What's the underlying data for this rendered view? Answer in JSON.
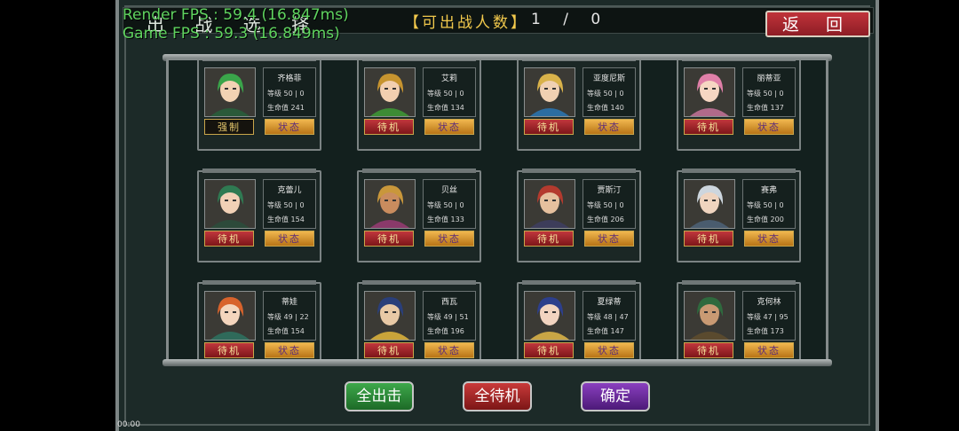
{
  "header": {
    "title": "出 战 选 择",
    "count_label": "【可出战人数】",
    "count_value": "1 / 0",
    "back_label": "返 回"
  },
  "debug": {
    "render_fps": "Render FPS : 59.4 (16.847ms)",
    "game_fps": "Game FPS : 59.3 (16.849ms)"
  },
  "status_label": "状态",
  "level_prefix": "等级",
  "hp_prefix": "生命值",
  "characters": [
    {
      "name": "齐格菲",
      "level": "50 | 0",
      "hp": "241",
      "state": "强制",
      "palette": {
        "hair": "#3aa54a",
        "skin": "#f2d2b3",
        "cloth": "#2a5a3a"
      }
    },
    {
      "name": "艾莉",
      "level": "50 | 0",
      "hp": "134",
      "state": "待机",
      "palette": {
        "hair": "#c7942f",
        "skin": "#f2cfb0",
        "cloth": "#3d8c35"
      }
    },
    {
      "name": "亚度尼斯",
      "level": "50 | 0",
      "hp": "140",
      "state": "待机",
      "palette": {
        "hair": "#d9b24a",
        "skin": "#f0d0b2",
        "cloth": "#2c6da1"
      }
    },
    {
      "name": "丽蒂亚",
      "level": "50 | 0",
      "hp": "137",
      "state": "待机",
      "palette": {
        "hair": "#e07fa8",
        "skin": "#f6d6c2",
        "cloth": "#b06a8a"
      }
    },
    {
      "name": "克蕾儿",
      "level": "50 | 0",
      "hp": "154",
      "state": "待机",
      "palette": {
        "hair": "#2f7a52",
        "skin": "#f2d1b6",
        "cloth": "#2d4a3a"
      }
    },
    {
      "name": "贝丝",
      "level": "50 | 0",
      "hp": "133",
      "state": "待机",
      "palette": {
        "hair": "#c9973b",
        "skin": "#c98c5e",
        "cloth": "#8a3a6a"
      }
    },
    {
      "name": "贾斯汀",
      "level": "50 | 0",
      "hp": "206",
      "state": "待机",
      "palette": {
        "hair": "#b43a2e",
        "skin": "#e6c09e",
        "cloth": "#3d3d5a"
      }
    },
    {
      "name": "赛弗",
      "level": "50 | 0",
      "hp": "200",
      "state": "待机",
      "palette": {
        "hair": "#cdd6de",
        "skin": "#efd4bf",
        "cloth": "#4a5c6e"
      }
    },
    {
      "name": "蒂娃",
      "level": "49 | 22",
      "hp": "154",
      "state": "待机",
      "palette": {
        "hair": "#d8632c",
        "skin": "#f4d5bd",
        "cloth": "#2f6a5a"
      }
    },
    {
      "name": "西瓦",
      "level": "49 | 51",
      "hp": "196",
      "state": "待机",
      "palette": {
        "hair": "#2a3f7a",
        "skin": "#e8c9a6",
        "cloth": "#c9a43a"
      }
    },
    {
      "name": "夏绿蒂",
      "level": "48 | 47",
      "hp": "147",
      "state": "待机",
      "palette": {
        "hair": "#2d3f8c",
        "skin": "#f2d4c0",
        "cloth": "#c8a545"
      }
    },
    {
      "name": "克何林",
      "level": "47 | 95",
      "hp": "173",
      "state": "待机",
      "palette": {
        "hair": "#2f6a3e",
        "skin": "#c99a73",
        "cloth": "#5a4a2e"
      }
    }
  ],
  "footer": {
    "all_sortie_label": "全出击",
    "all_standby_label": "全待机",
    "confirm_label": "确定"
  },
  "clock": "00:00"
}
